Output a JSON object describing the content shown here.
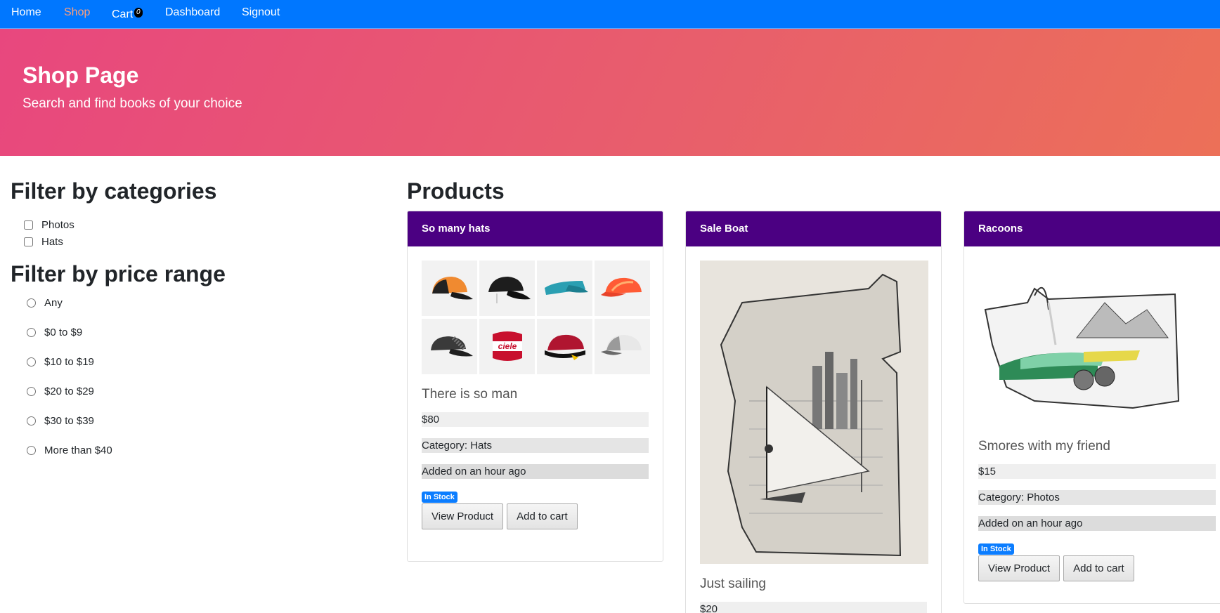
{
  "nav": {
    "items": [
      {
        "label": "Home",
        "active": false
      },
      {
        "label": "Shop",
        "active": true
      },
      {
        "label": "Cart",
        "active": false
      },
      {
        "label": "Dashboard",
        "active": false
      },
      {
        "label": "Signout",
        "active": false
      }
    ],
    "cart_count": "0"
  },
  "hero": {
    "title": "Shop Page",
    "subtitle": "Search and find books of your choice"
  },
  "filters": {
    "categories_title": "Filter by categories",
    "categories": [
      "Photos",
      "Hats"
    ],
    "price_title": "Filter by price range",
    "price_ranges": [
      "Any",
      "$0 to $9",
      "$10 to $19",
      "$20 to $29",
      "$30 to $39",
      "More than $40"
    ]
  },
  "products": {
    "title": "Products",
    "items": [
      {
        "name": "So many hats",
        "description": "There is so man",
        "price": "$80",
        "category": "Category: Hats",
        "added": "Added on an hour ago",
        "stock": "In Stock",
        "view_label": "View Product",
        "cart_label": "Add to cart",
        "image": "hats-collage"
      },
      {
        "name": "Sale Boat",
        "description": "Just sailing",
        "price": "$20",
        "image": "sailboat-sketch"
      },
      {
        "name": "Racoons",
        "description": "Smores with my friend",
        "price": "$15",
        "category": "Category: Photos",
        "added": "Added on an hour ago",
        "stock": "In Stock",
        "view_label": "View Product",
        "cart_label": "Add to cart",
        "image": "racoons-drawing"
      }
    ]
  },
  "colors": {
    "navbar": "#0077ff",
    "nav_active": "#ff9f7a",
    "hero_start": "#e8477e",
    "hero_end": "#ec7058",
    "card_header": "#4b0082",
    "stock_badge": "#0b7dff"
  }
}
